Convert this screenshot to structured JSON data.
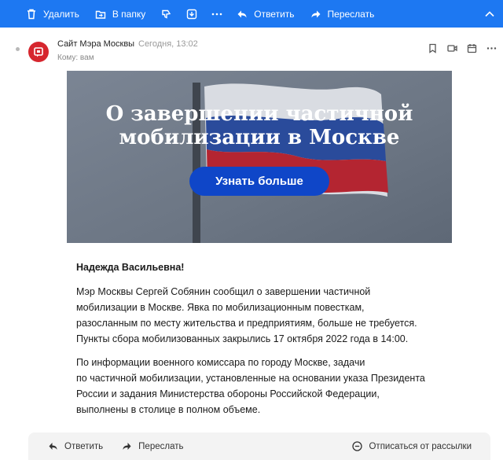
{
  "toolbar": {
    "delete": "Удалить",
    "to_folder": "В папку",
    "reply": "Ответить",
    "forward": "Переслать",
    "bg_color": "#1d78f2"
  },
  "message": {
    "sender": "Сайт Мэра Москвы",
    "date": "Сегодня, 13:02",
    "to": "Кому: вам",
    "avatar_color": "#d6262e"
  },
  "banner": {
    "title_line1": "О завершении частичной",
    "title_line2": "мобилизации в Москве",
    "button": "Узнать больше",
    "button_color": "#0f46c8"
  },
  "body": {
    "greeting": "Надежда Васильевна!",
    "para1": [
      "Мэр Москвы Сергей Собянин сообщил о завершении частичной",
      "мобилизации в Москве. Явка по мобилизационным повесткам,",
      "разосланным по месту жительства и предприятиям, больше не требуется.",
      "Пункты сбора мобилизованных закрылись 17 октября 2022 года в 14:00."
    ],
    "para2": [
      "По информации военного комиссара по городу Москве, задачи",
      "по частичной мобилизации, установленные на основании указа Президента",
      "России и задания Министерства обороны Российской Федерации,",
      "выполнены в столице в полном объеме."
    ]
  },
  "footer": {
    "reply": "Ответить",
    "forward": "Переслать",
    "unsubscribe": "Отписаться от рассылки"
  }
}
